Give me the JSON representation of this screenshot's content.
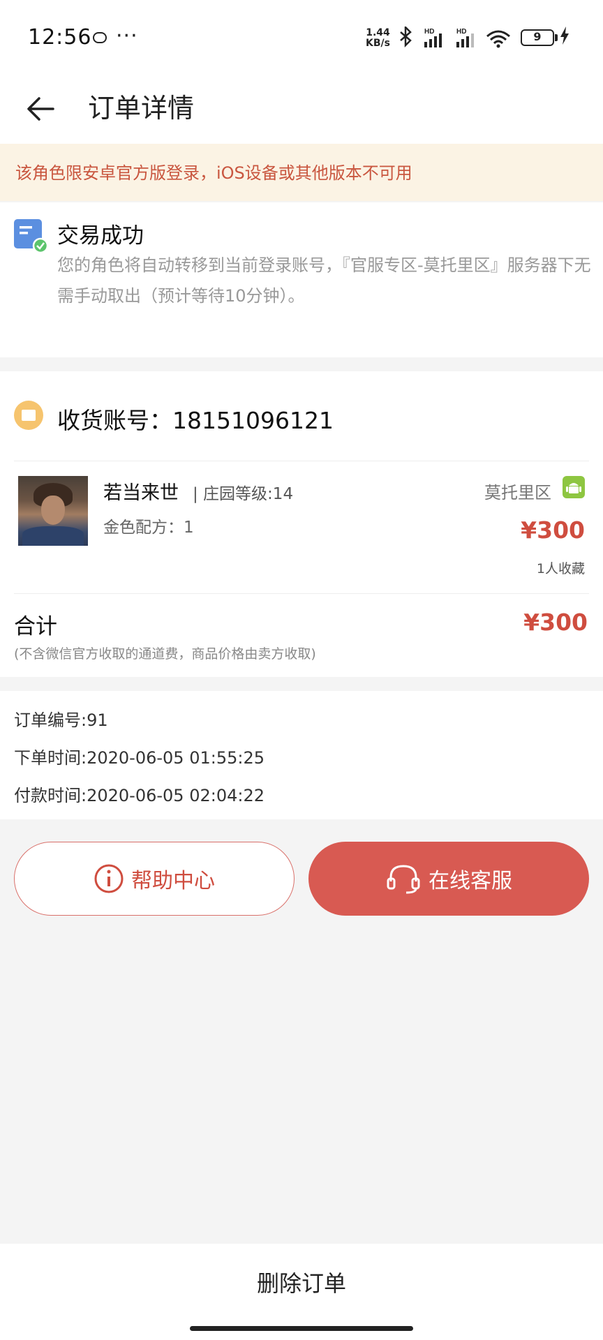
{
  "status_bar": {
    "time": "12:56",
    "dots": "···",
    "speed_value": "1.44",
    "speed_unit": "KB/s",
    "signal_label": "HD",
    "battery": "9"
  },
  "header": {
    "title": "订单详情"
  },
  "notice": {
    "text": "该角色限安卓官方版登录，iOS设备或其他版本不可用"
  },
  "status_card": {
    "title": "交易成功",
    "description": "您的角色将自动转移到当前登录账号，『官服专区-莫托里区』服务器下无需手动取出（预计等待10分钟）。"
  },
  "order_card": {
    "account_label": "收货账号：18151096121",
    "character_name": "若当来世",
    "character_level": "| 庄园等级:14",
    "character_detail": "金色配方：1",
    "server": "莫托里区",
    "price": "¥300",
    "favorites": "1人收藏",
    "total_label": "合计",
    "total_price": "¥300",
    "total_note": "(不含微信官方收取的通道费，商品价格由卖方收取)"
  },
  "info": {
    "order_no": "订单编号:91",
    "order_time": "下单时间:2020-06-05 01:55:25",
    "pay_time": "付款时间:2020-06-05 02:04:22"
  },
  "actions": {
    "help_label": "帮助中心",
    "service_label": "在线客服",
    "delete_label": "删除订单"
  },
  "colors": {
    "accent_red": "#d85a52",
    "price_red": "#cf4d3f",
    "notice_bg": "#fbf3e4",
    "android_green": "#8ec641",
    "mail_yellow": "#f6c46e"
  },
  "icons": [
    "message-icon",
    "bluetooth-icon",
    "signal-icon",
    "wifi-icon",
    "battery-icon",
    "charging-icon",
    "back-arrow-icon",
    "order-success-icon",
    "mail-icon",
    "android-icon",
    "info-icon",
    "headset-icon"
  ]
}
